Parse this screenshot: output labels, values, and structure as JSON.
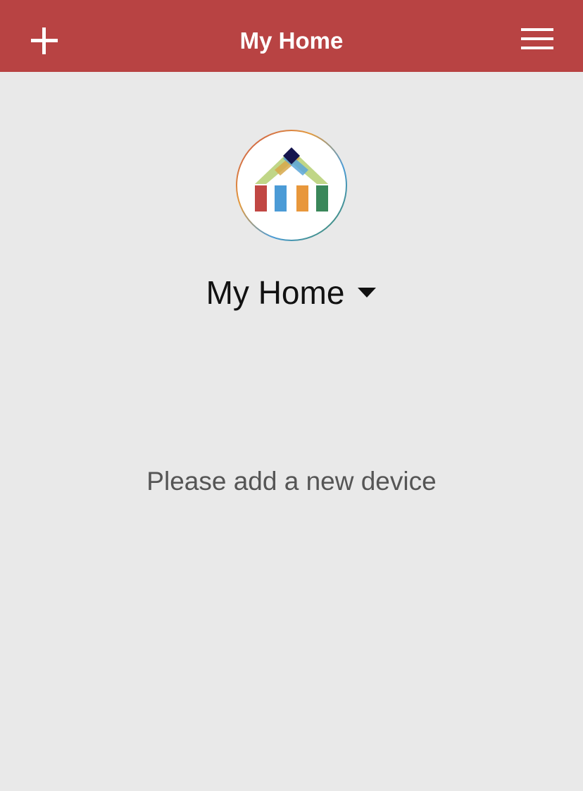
{
  "header": {
    "title": "My Home",
    "add_icon": "plus-icon",
    "menu_icon": "hamburger-menu-icon",
    "background_color": "#b84343"
  },
  "home": {
    "logo_icon": "home-logo-icon",
    "name": "My Home",
    "dropdown_icon": "caret-down-icon"
  },
  "empty_state": {
    "message": "Please add a new device"
  },
  "colors": {
    "page_background": "#e9e9e9",
    "header_text": "#ffffff",
    "message_text": "#555555"
  }
}
